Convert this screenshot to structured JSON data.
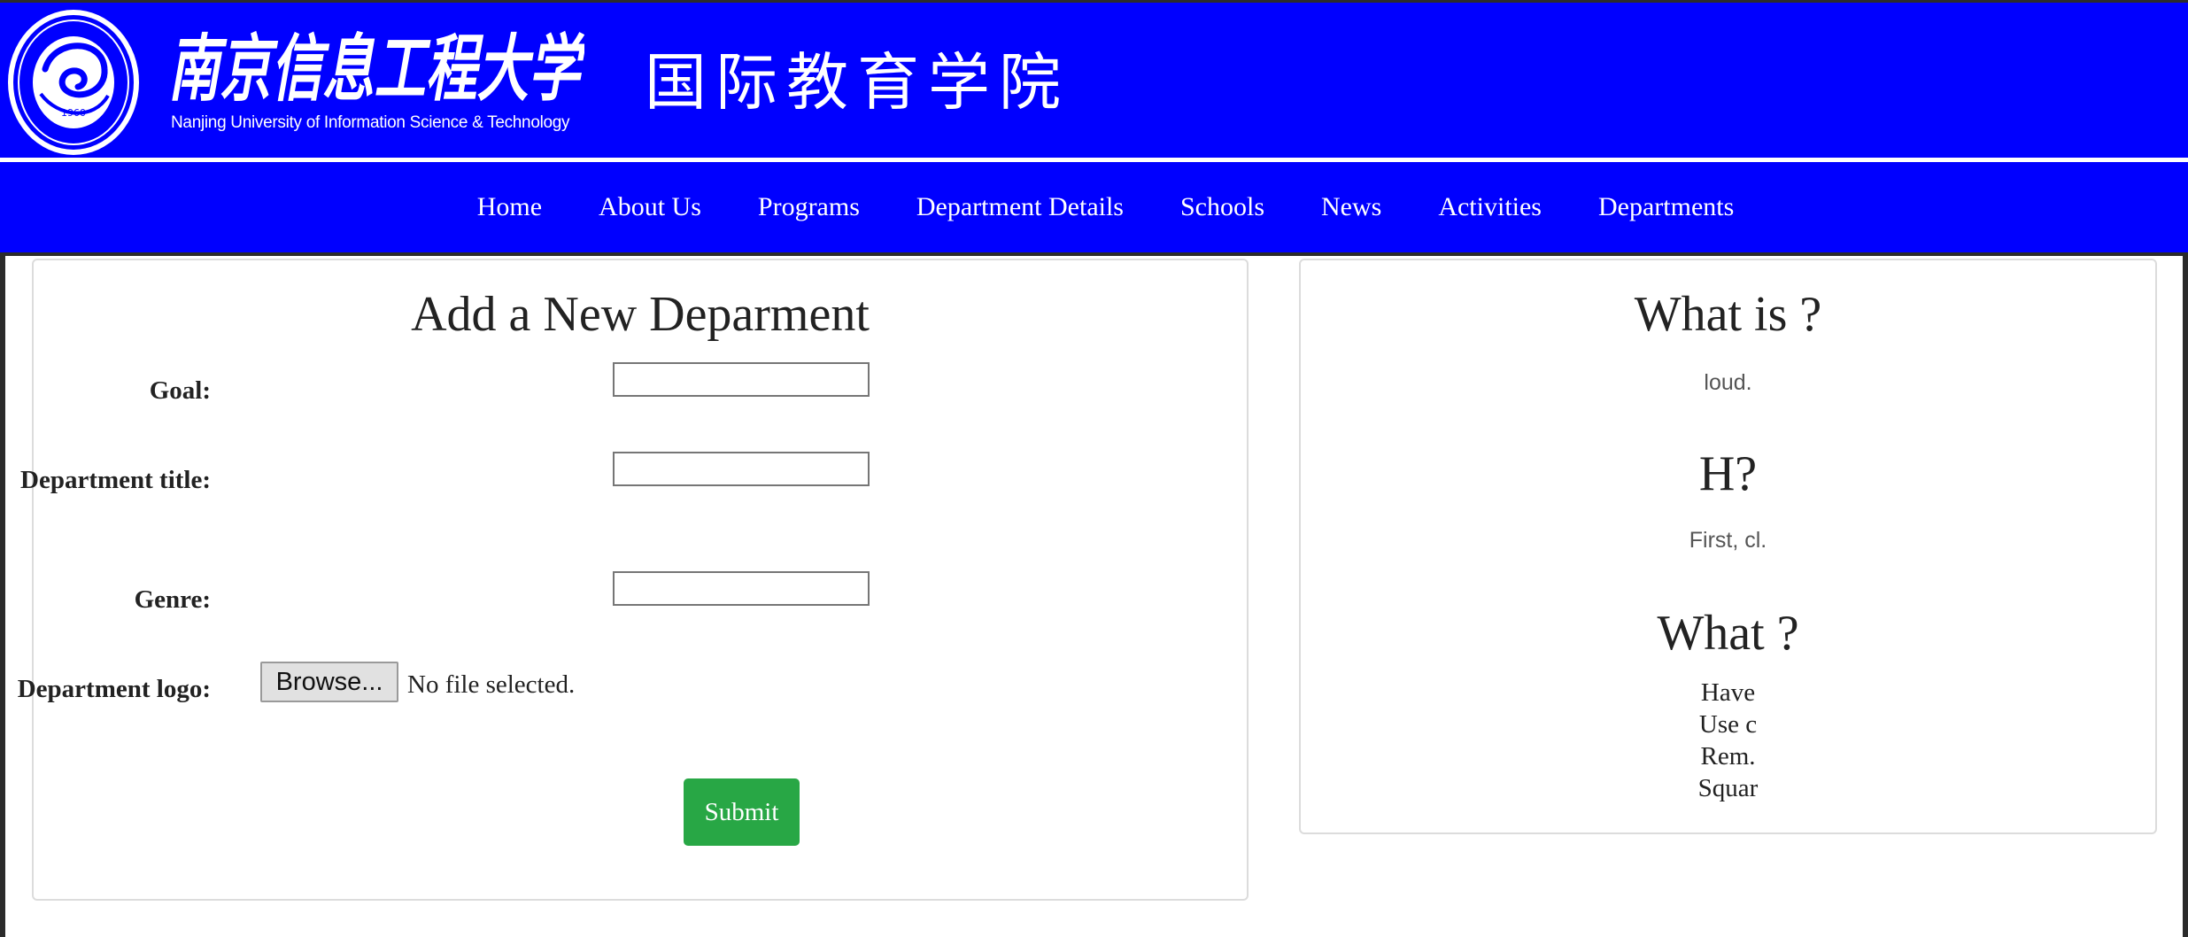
{
  "header": {
    "university_name_cn": "南京信息工程大学",
    "university_name_en": "Nanjing University of Information Science & Technology",
    "seal_year": "1960",
    "college_name": "国际教育学院"
  },
  "nav": {
    "items": [
      "Home",
      "About Us",
      "Programs",
      "Department Details",
      "Schools",
      "News",
      "Activities",
      "Departments"
    ]
  },
  "form": {
    "title": "Add a New Deparment",
    "goal_label": "Goal:",
    "goal_value": "",
    "title_label": "Department title:",
    "title_value": "",
    "genre_label": "Genre:",
    "genre_value": "",
    "logo_label": "Department logo:",
    "browse_label": "Browse...",
    "file_status": "No file selected.",
    "submit_label": "Submit"
  },
  "faq": {
    "q1": "What is ?",
    "a1": "loud.",
    "q2": "H?",
    "a2": "First, cl.",
    "q3": "What ?",
    "list": [
      "Have",
      "Use c",
      "Rem.",
      "Squar"
    ]
  },
  "colors": {
    "brand_blue": "#0000ff",
    "submit_green": "#28a745"
  }
}
